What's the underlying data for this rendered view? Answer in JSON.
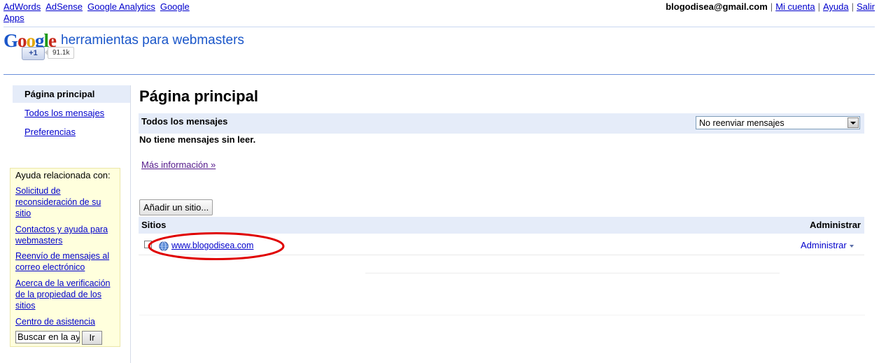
{
  "topnav": {
    "links": [
      "AdWords",
      "AdSense",
      "Google Analytics",
      "Google Apps"
    ]
  },
  "userbar": {
    "email": "blogodisea@gmail.com",
    "links": [
      "Mi cuenta",
      "Ayuda",
      "Salir"
    ]
  },
  "header": {
    "logo_letters": [
      "G",
      "o",
      "o",
      "g",
      "l",
      "e"
    ],
    "product_name": "herramientas para webmasters",
    "plusone_label": "+1",
    "plusone_count": "91.1k"
  },
  "sidebar": {
    "items": [
      "Página principal",
      "Todos los mensajes",
      "Preferencias"
    ],
    "active_index": 0
  },
  "help": {
    "title": "Ayuda relacionada con:",
    "links": [
      "Solicitud de reconsideración de su sitio",
      "Contactos y ayuda para webmasters",
      "Reenvío de mensajes al correo electrónico",
      "Acerca de la verificación de la propiedad de los sitios",
      "Centro de asistencia"
    ],
    "search_value": "Buscar en la ay",
    "go_label": "Ir"
  },
  "main": {
    "title": "Página principal",
    "messages": {
      "header": "Todos los mensajes",
      "forward_select": "No reenviar mensajes",
      "empty_text": "No tiene mensajes sin leer.",
      "more_info": "Más información »"
    },
    "add_site_label": "Añadir un sitio...",
    "sites": {
      "col_sites": "Sitios",
      "col_admin": "Administrar",
      "rows": [
        {
          "url": "www.blogodisea.com",
          "admin_label": "Administrar"
        }
      ]
    }
  },
  "colors": {
    "accent_bar": "#e5ecf9",
    "link": "#0000cc",
    "visited_link": "#551a8b",
    "annotation": "#e00000",
    "help_bg": "#ffffdd"
  },
  "icons": [
    "globe-icon",
    "dropdown-arrow-icon"
  ]
}
